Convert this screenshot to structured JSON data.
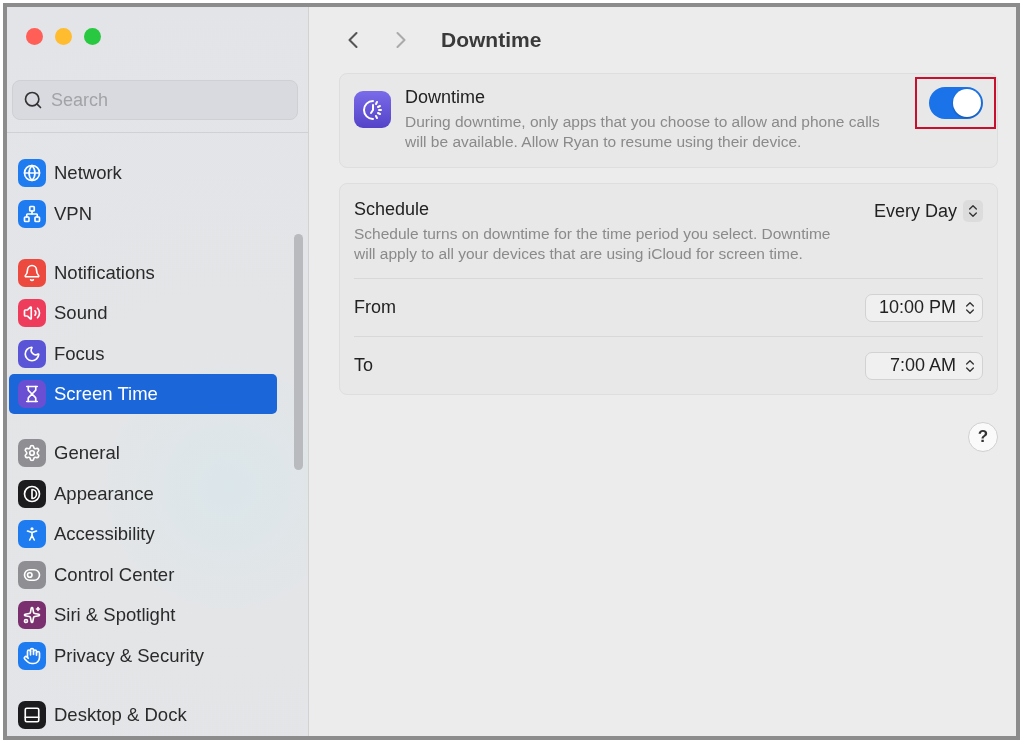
{
  "sidebar": {
    "search": {
      "placeholder": "Search"
    },
    "groups": [
      [
        {
          "label": "Network",
          "color": "#1e7cf0",
          "selected": false
        },
        {
          "label": "VPN",
          "color": "#1e7cf0",
          "selected": false
        }
      ],
      [
        {
          "label": "Notifications",
          "color": "#ec4a3f",
          "selected": false
        },
        {
          "label": "Sound",
          "color": "#ee3d5c",
          "selected": false
        },
        {
          "label": "Focus",
          "color": "#5a55d6",
          "selected": false
        },
        {
          "label": "Screen Time",
          "color": "#6a4fd2",
          "selected": true
        }
      ],
      [
        {
          "label": "General",
          "color": "#8e8e93",
          "selected": false
        },
        {
          "label": "Appearance",
          "color": "#1c1c1e",
          "selected": false
        },
        {
          "label": "Accessibility",
          "color": "#1e7cf0",
          "selected": false
        },
        {
          "label": "Control Center",
          "color": "#8e8e93",
          "selected": false
        },
        {
          "label": "Siri & Spotlight",
          "color": "#7a2f6e",
          "selected": false
        },
        {
          "label": "Privacy & Security",
          "color": "#1e7cf0",
          "selected": false
        }
      ],
      [
        {
          "label": "Desktop & Dock",
          "color": "#1c1c1e",
          "selected": false
        }
      ]
    ]
  },
  "header": {
    "title": "Downtime"
  },
  "downtime": {
    "title": "Downtime",
    "description": "During downtime, only apps that you choose to allow and phone calls will be available. Allow Ryan to resume using their device.",
    "on": true,
    "highlighted": true
  },
  "schedule": {
    "title": "Schedule",
    "value": "Every Day",
    "description": "Schedule turns on downtime for the time period you select. Downtime will apply to all your devices that are using iCloud for screen time.",
    "rows": [
      {
        "label": "From",
        "value": "10:00 PM"
      },
      {
        "label": "To",
        "value": "7:00 AM"
      }
    ]
  },
  "help": "?"
}
